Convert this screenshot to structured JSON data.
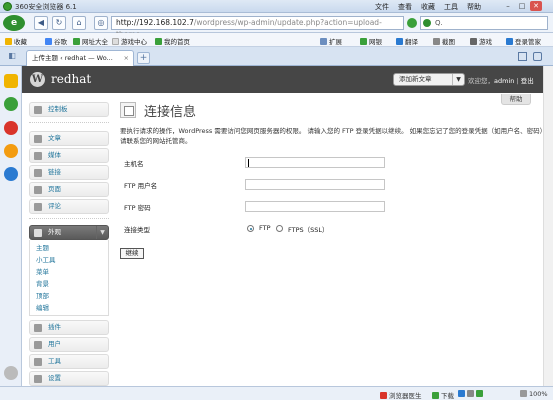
{
  "browser": {
    "title": "360安全浏览器 6.1",
    "menu": [
      "文件",
      "查看",
      "收藏",
      "工具",
      "帮助"
    ],
    "url_host": "http://192.168.102.7",
    "url_path": "/wordpress/wp-admin/update.php?action=upload-theme",
    "search_placeholder": "Q.",
    "bookmarks": [
      "收藏",
      "谷歌",
      "网址大全",
      "游戏中心",
      "我的首页"
    ],
    "toolbar_right": [
      "扩展",
      "网银",
      "翻译",
      "截图",
      "游戏",
      "登录管家"
    ],
    "tab_label": "上传主题 ‹ redhat — Wo...",
    "new_tab": "+",
    "status": {
      "doctor": "浏览器医生",
      "download": "下载",
      "zoom": "100%"
    }
  },
  "wp": {
    "site_name": "redhat",
    "logo_glyph": "W",
    "new_post": "添加新文章",
    "greeting_prefix": "欢迎您，",
    "user": "admin",
    "logout": "登出",
    "help": "帮助",
    "menu": {
      "dashboard": "控制板",
      "posts": "文章",
      "media": "媒体",
      "links": "链接",
      "pages": "页面",
      "comments": "评论",
      "appearance": "外观",
      "appearance_sub": [
        "主题",
        "小工具",
        "菜单",
        "背景",
        "顶部",
        "编辑"
      ],
      "plugins": "插件",
      "users": "用户",
      "tools": "工具",
      "settings": "设置"
    },
    "page_title": "连接信息",
    "description": "要执行请求的操作，WordPress 需要访问您网页服务器的权限。 请输入您的 FTP 登录凭据以继续。 如果您忘记了您的登录凭据（如用户名、密码），请联系您的网站托管商。",
    "fields": {
      "hostname_label": "主机名",
      "ftp_user_label": "FTP 用户名",
      "ftp_pass_label": "FTP 密码",
      "conn_type_label": "连接类型",
      "ftp_option": "FTP",
      "ftps_option": "FTPS（SSL）"
    },
    "submit": "继续"
  }
}
